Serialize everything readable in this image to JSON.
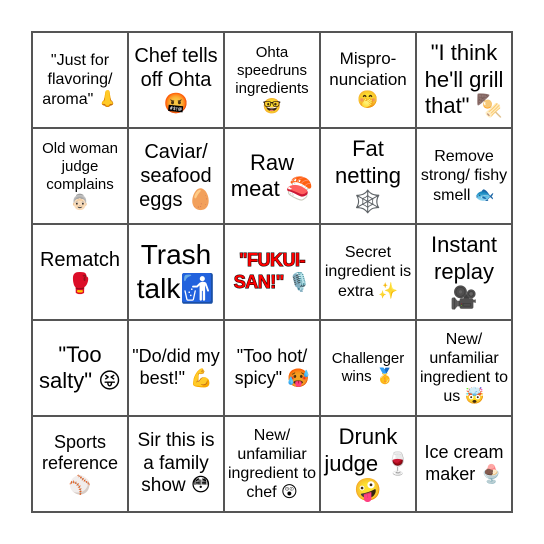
{
  "board": {
    "cells": [
      "\"Just for flavoring/ aroma\" 👃",
      "Chef tells off Ohta 🤬",
      "Ohta speedruns ingredients 🤓",
      "Mispro-nunciation 🤭",
      "\"I think he'll grill that\" 🍢",
      "Old woman judge complains 👵🏻",
      "Caviar/ seafood eggs 🥚",
      "Raw meat 🍣",
      "Fat netting 🕸️",
      "Remove strong/ fishy smell 🐟",
      "Rematch 🥊",
      "Trash talk🚮",
      "\"FUKUI-SAN!\" 🎙️",
      "Secret ingredient is extra ✨",
      "Instant replay 🎥",
      "\"Too salty\" 😝",
      "\"Do/did my best!\" 💪",
      "\"Too hot/ spicy\" 🥵",
      "Challenger wins 🥇",
      "New/ unfamiliar ingredient to us 🤯",
      "Sports reference ⚾",
      "Sir this is a family show 😳",
      "New/ unfamiliar ingredient to chef 😲",
      "Drunk judge 🍷 🤪",
      "Ice cream maker 🍨"
    ],
    "free_cell_index": 12,
    "free_cell_color": "#ff0000"
  }
}
